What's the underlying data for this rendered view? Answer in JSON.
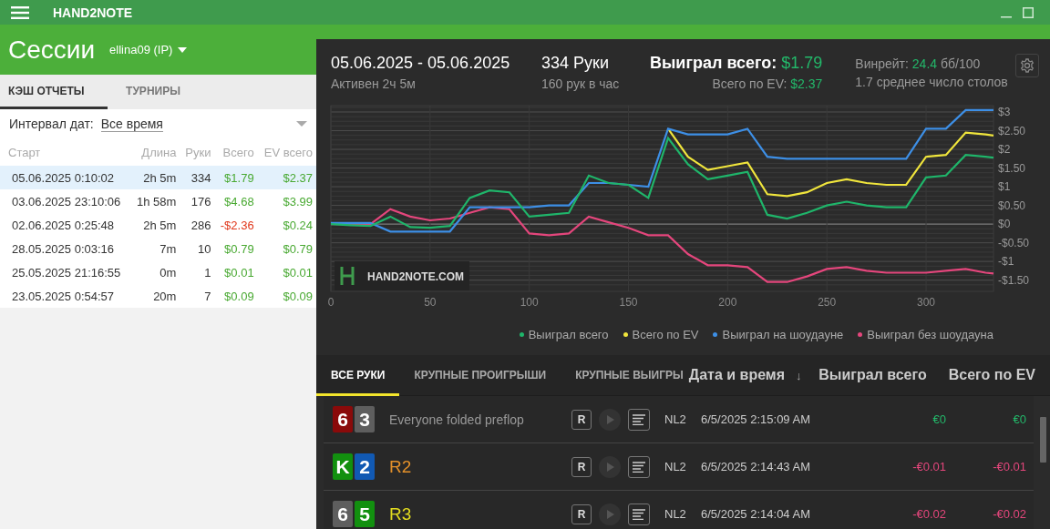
{
  "app": {
    "title": "HAND2NOTE"
  },
  "sessions": {
    "title": "Сессии",
    "player": "ellina09 (IP)",
    "tabs": [
      {
        "label": "КЭШ ОТЧЕТЫ",
        "selected": true
      },
      {
        "label": "ТУРНИРЫ",
        "selected": false
      }
    ],
    "date_filter": {
      "label": "Интервал дат:",
      "value": "Все время"
    },
    "columns": [
      "Старт",
      "Длина",
      "Руки",
      "Всего",
      "EV всего"
    ],
    "rows": [
      {
        "start": "05.06.2025 0:10:02",
        "length": "2h 5m",
        "hands": "334",
        "total": "$1.79",
        "total_negative": false,
        "ev": "$2.37",
        "selected": true
      },
      {
        "start": "03.06.2025 23:10:06",
        "length": "1h 58m",
        "hands": "176",
        "total": "$4.68",
        "total_negative": false,
        "ev": "$3.99",
        "selected": false
      },
      {
        "start": "02.06.2025 0:25:48",
        "length": "2h 5m",
        "hands": "286",
        "total": "-$2.36",
        "total_negative": true,
        "ev": "$0.24",
        "selected": false
      },
      {
        "start": "28.05.2025 0:03:16",
        "length": "7m",
        "hands": "10",
        "total": "$0.79",
        "total_negative": false,
        "ev": "$0.79",
        "selected": false
      },
      {
        "start": "25.05.2025 21:16:55",
        "length": "0m",
        "hands": "1",
        "total": "$0.01",
        "total_negative": false,
        "ev": "$0.01",
        "selected": false
      },
      {
        "start": "23.05.2025 0:54:57",
        "length": "20m",
        "hands": "7",
        "total": "$0.09",
        "total_negative": false,
        "ev": "$0.09",
        "selected": false
      }
    ]
  },
  "summary": {
    "date_range": "05.06.2025 - 05.06.2025",
    "active": "Активен 2ч 5м",
    "hands": "334 Руки",
    "hands_per_hour": "160 рук в час",
    "won_label": "Выиграл всего:",
    "won_value": "$1.79",
    "ev_label": "Всего по EV:",
    "ev_value": "$2.37",
    "winrate_label": "Винрейт:",
    "winrate_value": "24.4",
    "winrate_unit": "бб/100",
    "tables": "1.7 среднее число столов"
  },
  "chart": {
    "logo_text": "HAND2NOTE.COM",
    "chart_data": {
      "type": "line",
      "x": [
        0,
        10,
        20,
        30,
        40,
        50,
        60,
        70,
        80,
        90,
        100,
        110,
        120,
        130,
        140,
        150,
        160,
        170,
        180,
        190,
        200,
        210,
        220,
        230,
        240,
        250,
        260,
        270,
        280,
        290,
        300,
        310,
        320,
        330,
        334
      ],
      "series": [
        {
          "name": "Выиграл всего",
          "color": "#1fb56a",
          "values": [
            0,
            -0.03,
            -0.05,
            0.2,
            -0.08,
            -0.1,
            -0.05,
            0.7,
            0.9,
            0.85,
            0.2,
            0.25,
            0.3,
            1.3,
            1.1,
            1.05,
            0.7,
            2.3,
            1.6,
            1.2,
            1.3,
            1.4,
            0.25,
            0.15,
            0.3,
            0.5,
            0.6,
            0.5,
            0.45,
            0.45,
            1.25,
            1.3,
            1.85,
            1.8,
            1.78
          ]
        },
        {
          "name": "Всего по EV",
          "color": "#f0e53c",
          "values": [
            null,
            null,
            null,
            null,
            null,
            null,
            null,
            null,
            null,
            null,
            null,
            null,
            null,
            null,
            null,
            null,
            null,
            2.55,
            1.8,
            1.45,
            1.55,
            1.65,
            0.8,
            0.75,
            0.85,
            1.1,
            1.2,
            1.1,
            1.05,
            1.05,
            1.8,
            1.85,
            2.45,
            2.4,
            2.37
          ]
        },
        {
          "name": "Выиграл на шоудауне",
          "color": "#3d8fe6",
          "values": [
            0.03,
            0.03,
            0.03,
            -0.2,
            -0.2,
            -0.2,
            -0.2,
            0.45,
            0.45,
            0.45,
            0.45,
            0.5,
            0.5,
            1.1,
            1.1,
            1.05,
            1.0,
            2.55,
            2.4,
            2.4,
            2.4,
            2.55,
            1.8,
            1.75,
            1.75,
            1.75,
            1.75,
            1.75,
            1.75,
            1.75,
            2.55,
            2.55,
            3.05,
            3.05,
            3.05
          ]
        },
        {
          "name": "Выиграл без шоудауна",
          "color": "#e4467c",
          "values": [
            0,
            0,
            0,
            0.4,
            0.2,
            0.1,
            0.15,
            0.3,
            0.45,
            0.4,
            -0.25,
            -0.3,
            -0.25,
            0.2,
            0.05,
            -0.1,
            -0.3,
            -0.3,
            -0.8,
            -1.1,
            -1.1,
            -1.15,
            -1.55,
            -1.55,
            -1.4,
            -1.2,
            -1.15,
            -1.25,
            -1.3,
            -1.3,
            -1.3,
            -1.25,
            -1.2,
            -1.3,
            -1.32
          ]
        }
      ],
      "xlim": [
        0,
        334
      ],
      "ylim": [
        -1.8,
        3.17
      ],
      "grid": true,
      "xticks": [
        0,
        50,
        100,
        150,
        200,
        250,
        300
      ],
      "yticks": [
        {
          "value": 3,
          "label": "$3"
        },
        {
          "value": 2.5,
          "label": "$2.50"
        },
        {
          "value": 2,
          "label": "$2"
        },
        {
          "value": 1.5,
          "label": "$1.50"
        },
        {
          "value": 1,
          "label": "$1"
        },
        {
          "value": 0.5,
          "label": "$0.50"
        },
        {
          "value": 0,
          "label": "$0"
        },
        {
          "value": -0.5,
          "label": "-$0.50"
        },
        {
          "value": -1,
          "label": "-$1"
        },
        {
          "value": -1.5,
          "label": "-$1.50"
        }
      ]
    }
  },
  "hand_tabs": [
    {
      "label": "ВСЕ РУКИ",
      "selected": true
    },
    {
      "label": "КРУПНЫЕ ПРОИГРЫШИ",
      "selected": false
    },
    {
      "label": "КРУПНЫЕ ВЫИГРЫ",
      "selected": false
    }
  ],
  "hand_columns": [
    {
      "label": "Дата и время",
      "sort": "↓"
    },
    {
      "label": "Выиграл всего"
    },
    {
      "label": "Всего по EV"
    }
  ],
  "hands": [
    {
      "cards": [
        {
          "rank": "6",
          "color": "#8a0a0a"
        },
        {
          "rank": "3",
          "color": "#5e5e5e"
        }
      ],
      "action": "Everyone folded preflop",
      "kind": "summary",
      "color": "#999999",
      "replay": "R",
      "limit": "NL2",
      "date": "6/5/2025 2:15:09 AM",
      "won": "€0",
      "won_negative": false,
      "ev": "€0",
      "ev_negative": false
    },
    {
      "cards": [
        {
          "rank": "K",
          "color": "#12900f"
        },
        {
          "rank": "2",
          "color": "#1159b3"
        }
      ],
      "action": "R2",
      "kind": "action",
      "color": "#e3902a",
      "replay": "R",
      "limit": "NL2",
      "date": "6/5/2025 2:14:43 AM",
      "won": "-€0.01",
      "won_negative": true,
      "ev": "-€0.01",
      "ev_negative": true
    },
    {
      "cards": [
        {
          "rank": "6",
          "color": "#5e5e5e"
        },
        {
          "rank": "5",
          "color": "#12900f"
        }
      ],
      "action": "R3",
      "kind": "action",
      "color": "#e2dc1f",
      "replay": "R",
      "limit": "NL2",
      "date": "6/5/2025 2:14:04 AM",
      "won": "-€0.02",
      "won_negative": true,
      "ev": "-€0.02",
      "ev_negative": true
    }
  ]
}
